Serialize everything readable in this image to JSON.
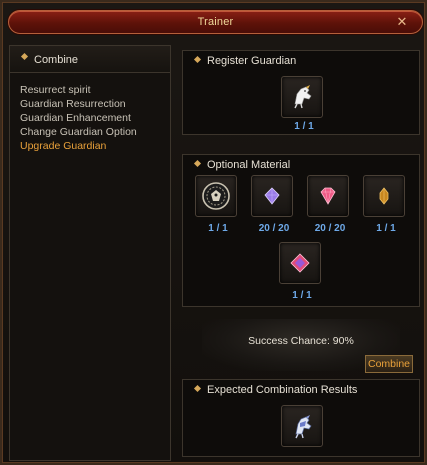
{
  "window": {
    "title": "Trainer"
  },
  "left_panel": {
    "header": "Combine",
    "menu": [
      {
        "label": "Resurrect spirit",
        "active": false
      },
      {
        "label": "Guardian Resurrection",
        "active": false
      },
      {
        "label": "Guardian Enhancement",
        "active": false
      },
      {
        "label": "Change Guardian Option",
        "active": false
      },
      {
        "label": "Upgrade Guardian",
        "active": true
      }
    ]
  },
  "register": {
    "title": "Register Guardian",
    "slot": {
      "icon": "guardian-horse-icon",
      "count": "1 / 1"
    }
  },
  "optional": {
    "title": "Optional Material",
    "slots": [
      {
        "icon": "medallion-icon",
        "count": "1 / 1"
      },
      {
        "icon": "purple-gem-icon",
        "count": "20 / 20"
      },
      {
        "icon": "pink-gem-icon",
        "count": "20 / 20"
      },
      {
        "icon": "amber-crystal-icon",
        "count": "1 / 1"
      },
      {
        "icon": "red-jewel-icon",
        "count": "1 / 1"
      }
    ]
  },
  "combine": {
    "success_text": "Success Chance: 90%",
    "button_label": "Combine"
  },
  "results": {
    "title": "Expected Combination Results",
    "slot": {
      "icon": "armored-guardian-icon"
    }
  },
  "colors": {
    "accent": "#e9a13a",
    "count_text": "#6ea9e8",
    "title_bar": "#6a150c"
  }
}
